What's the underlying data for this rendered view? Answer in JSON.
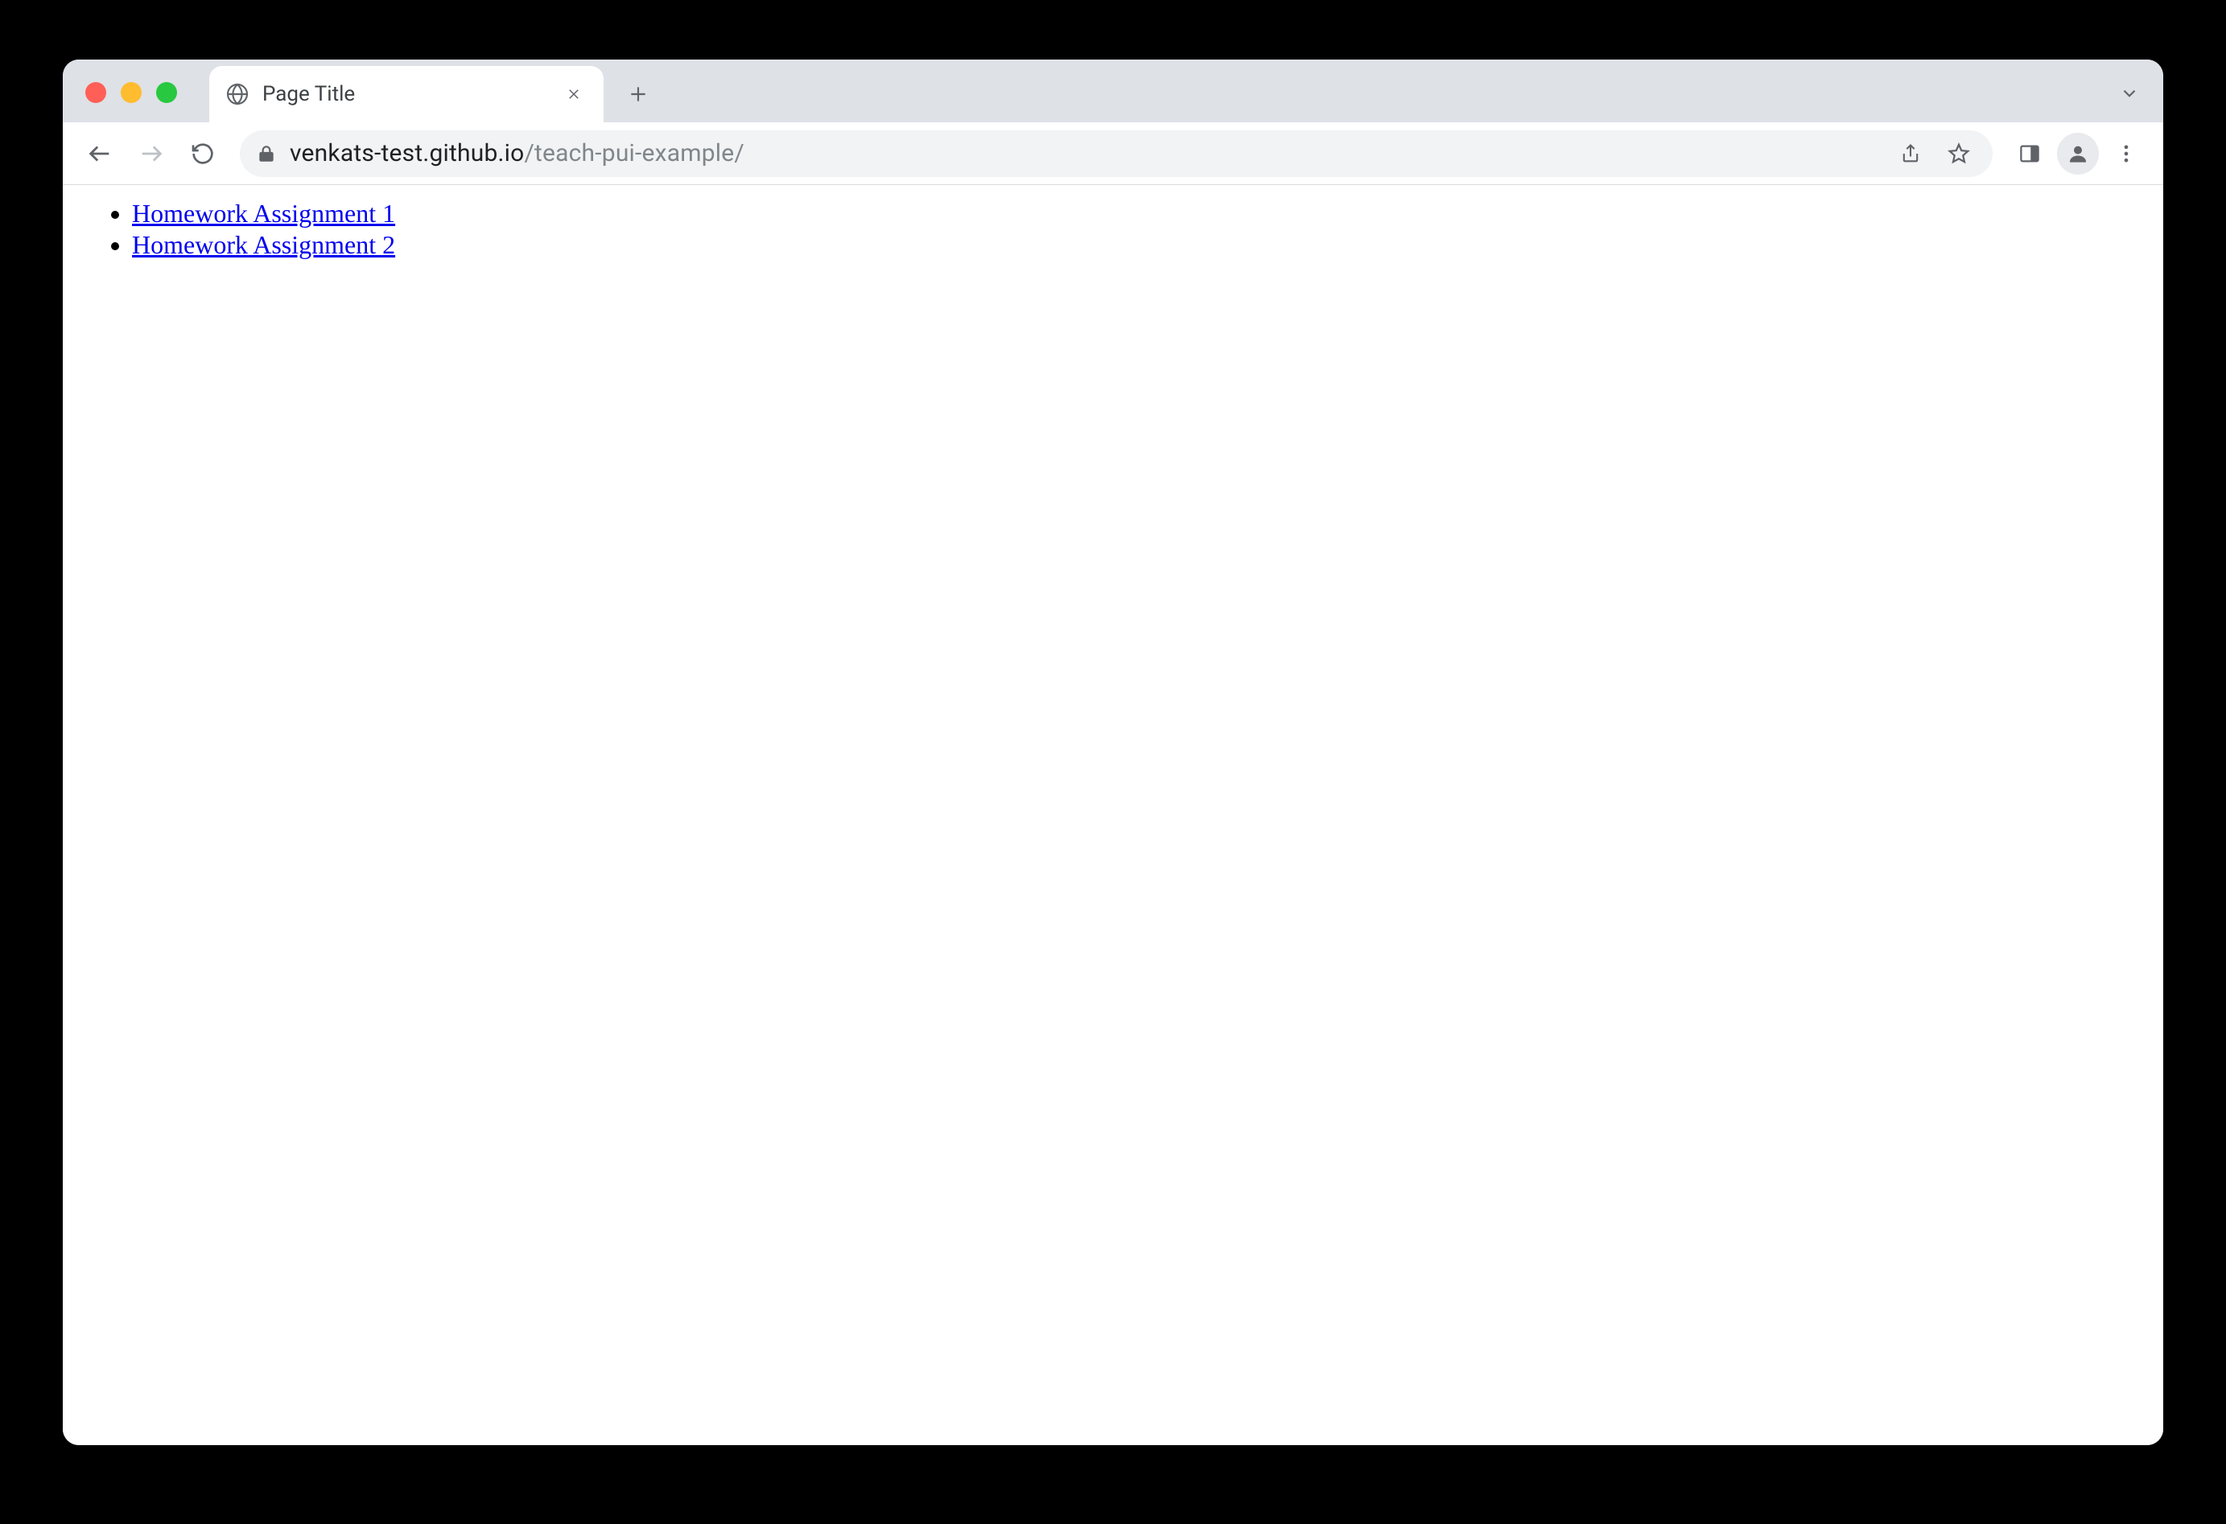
{
  "browser": {
    "tab": {
      "title": "Page Title",
      "favicon": "globe-icon"
    },
    "url": {
      "host": "venkats-test.github.io",
      "path": "/teach-pui-example/"
    },
    "icons": {
      "close": "close-icon",
      "new_tab": "plus-icon",
      "tabs_dropdown": "chevron-down-icon",
      "back": "arrow-left-icon",
      "forward": "arrow-right-icon",
      "reload": "reload-icon",
      "lock": "lock-icon",
      "share": "share-icon",
      "bookmark": "star-icon",
      "side_panel": "side-panel-icon",
      "profile": "person-icon",
      "menu": "kebab-menu-icon"
    }
  },
  "page": {
    "links": [
      {
        "label": "Homework Assignment 1"
      },
      {
        "label": "Homework Assignment 2"
      }
    ]
  }
}
